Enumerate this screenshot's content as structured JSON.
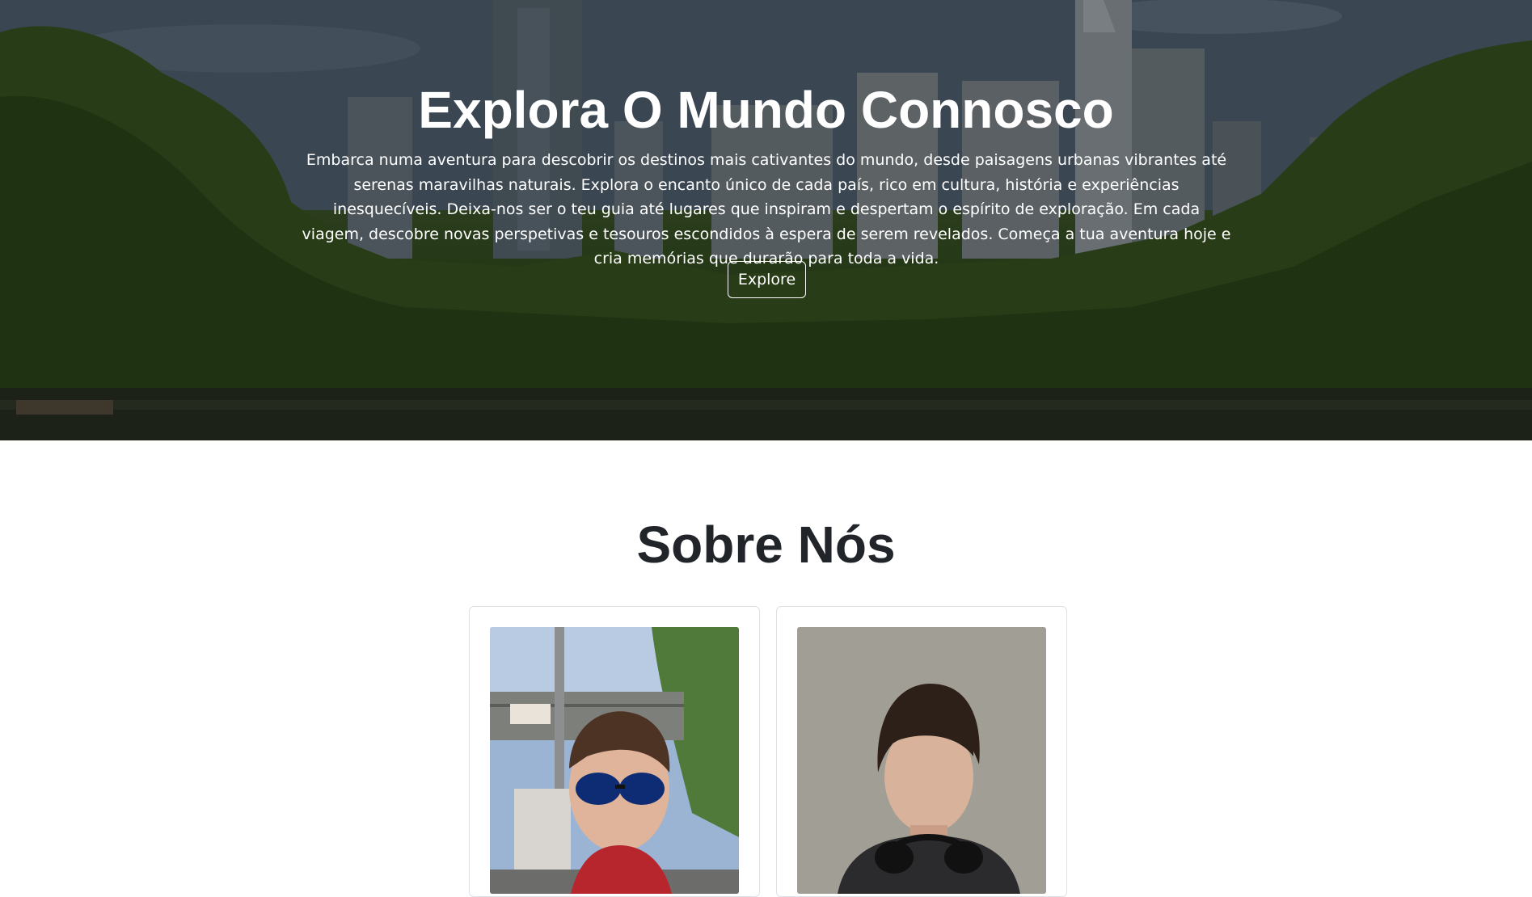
{
  "hero": {
    "title": "Explora O Mundo Connosco",
    "description": "Embarca numa aventura para descobrir os destinos mais cativantes do mundo, desde paisagens urbanas vibrantes até serenas maravilhas naturais. Explora o encanto único de cada país, rico em cultura, história e experiências inesquecíveis. Deixa-nos ser o teu guia até lugares que inspiram e despertam o espírito de exploração. Em cada viagem, descobre novas perspetivas e tesouros escondidos à espera de serem revelados. Começa a tua aventura hoje e cria memórias que durarão para toda a vida.",
    "button_label": "Explore"
  },
  "about": {
    "title": "Sobre Nós",
    "members": [
      {
        "photo": "team-member-photo-1"
      },
      {
        "photo": "team-member-photo-2"
      }
    ]
  },
  "colors": {
    "text_dark": "#212529",
    "hero_text": "#ffffff",
    "card_border": "#dee2e6"
  }
}
